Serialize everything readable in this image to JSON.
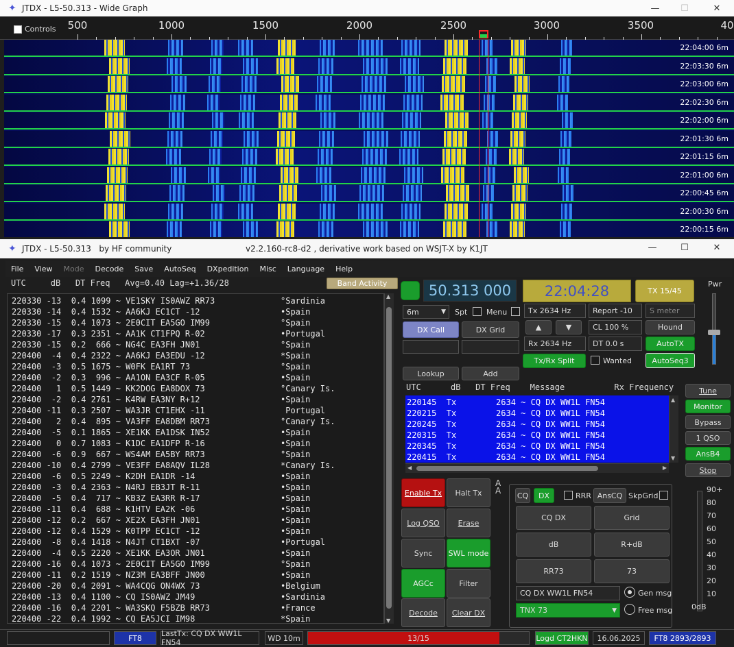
{
  "wide_graph": {
    "title": "JTDX - L5-50.313 - Wide Graph",
    "controls_label": "Controls",
    "scale_labels": [
      "500",
      "1000",
      "1500",
      "2000",
      "2500",
      "3000",
      "3500",
      "40"
    ],
    "rows": [
      {
        "time": "22:04:00",
        "band": "6m"
      },
      {
        "time": "22:03:30",
        "band": "6m"
      },
      {
        "time": "22:03:00",
        "band": "6m"
      },
      {
        "time": "22:02:30",
        "band": "6m"
      },
      {
        "time": "22:02:00",
        "band": "6m"
      },
      {
        "time": "22:01:30",
        "band": "6m"
      },
      {
        "time": "22:01:15",
        "band": "6m"
      },
      {
        "time": "22:01:00",
        "band": "6m"
      },
      {
        "time": "22:00:45",
        "band": "6m"
      },
      {
        "time": "22:00:30",
        "band": "6m"
      },
      {
        "time": "22:00:15",
        "band": "6m"
      }
    ]
  },
  "main": {
    "title_left": "JTDX - L5-50.313   by HF community",
    "title_right": "v2.2.160-rc8-d2 , derivative work based on WSJT-X by K1JT",
    "menu": [
      "File",
      "View",
      "Mode",
      "Decode",
      "Save",
      "AutoSeq",
      "DXpedition",
      "Misc",
      "Language",
      "Help"
    ],
    "decode_header": "UTC     dB   DT Freq   Avg=0.40 Lag=+1.36/28",
    "band_activity": "Band Activity",
    "decodes": [
      {
        "line": "220330 -13  0.4 1099 ~ VE1SKY IS0AWZ RR73",
        "country": "°Sardinia"
      },
      {
        "line": "220330 -14  0.4 1532 ~ AA6KJ EC1CT -12",
        "country": "•Spain"
      },
      {
        "line": "220330 -15  0.4 1073 ~ 2E0CIT EA5GO IM99",
        "country": "°Spain"
      },
      {
        "line": "220330 -17  0.3 2351 ~ AA1K CT1FPQ R-02",
        "country": "•Portugal"
      },
      {
        "line": "220330 -15  0.2  666 ~ NG4C EA3FH JN01",
        "country": "°Spain"
      },
      {
        "line": "220400  -4  0.4 2322 ~ AA6KJ EA3EDU -12",
        "country": "*Spain"
      },
      {
        "line": "220400  -3  0.5 1675 ~ W0FK EA1RT 73",
        "country": "°Spain"
      },
      {
        "line": "220400  -2  0.3  996 ~ AA1ON EA3CF R-05",
        "country": "•Spain"
      },
      {
        "line": "220400   1  0.5 1449 ~ KK2DOG EA8DOX 73",
        "country": "°Canary Is."
      },
      {
        "line": "220400  -2  0.4 2761 ~ K4RW EA3NY R+12",
        "country": "•Spain"
      },
      {
        "line": "220400 -11  0.3 2507 ~ WA3JR CT1EHX -11",
        "country": " Portugal"
      },
      {
        "line": "220400   2  0.4  895 ~ VA3FF EA8DBM RR73",
        "country": "°Canary Is."
      },
      {
        "line": "220400  -5  0.1 1865 ~ XE1KK EA1DSK IN52",
        "country": "•Spain"
      },
      {
        "line": "220400   0  0.7 1083 ~ K1DC EA1DFP R-16",
        "country": "•Spain"
      },
      {
        "line": "220400  -6  0.9  667 ~ WS4AM EA5BY RR73",
        "country": "°Spain"
      },
      {
        "line": "220400 -10  0.4 2799 ~ VE3FF EA8AQV IL28",
        "country": "*Canary Is."
      },
      {
        "line": "220400  -6  0.5 2249 ~ K2DH EA1DR -14",
        "country": "•Spain"
      },
      {
        "line": "220400  -3  0.4 2363 ~ N4RJ EB3JT R-11",
        "country": "•Spain"
      },
      {
        "line": "220400  -5  0.4  717 ~ KB3Z EA3RR R-17",
        "country": "•Spain"
      },
      {
        "line": "220400 -11  0.4  688 ~ K1HTV EA2K -06",
        "country": "•Spain"
      },
      {
        "line": "220400 -12  0.2  667 ~ XE2X EA3FH JN01",
        "country": "•Spain"
      },
      {
        "line": "220400 -12  0.4 1529 ~ K0TPP EC1CT -12",
        "country": "•Spain"
      },
      {
        "line": "220400  -8  0.4 1418 ~ N4JT CT1BXT -07",
        "country": "•Portugal"
      },
      {
        "line": "220400  -4  0.5 2220 ~ XE1KK EA3OR JN01",
        "country": "•Spain"
      },
      {
        "line": "220400 -16  0.4 1073 ~ 2E0CIT EA5GO IM99",
        "country": "°Spain"
      },
      {
        "line": "220400 -11  0.2 1519 ~ NZ3M EA3BFF JN00",
        "country": "•Spain"
      },
      {
        "line": "220400 -20  0.4 2091 ~ WA4CQG ON4WX 73",
        "country": "•Belgium"
      },
      {
        "line": "220400 -13  0.4 1100 ~ CQ IS0AWZ JM49",
        "country": "•Sardinia"
      },
      {
        "line": "220400 -16  0.4 2201 ~ WA3SKQ F5BZB RR73",
        "country": "•France"
      },
      {
        "line": "220400 -22  0.4 1992 ~ CQ EA5JCI IM98",
        "country": "*Spain"
      }
    ],
    "frequency": "50.313 000",
    "time": "22:04:28",
    "tx_period": "TX 15/45",
    "pwr_label": "Pwr",
    "pwr_level": 0.45,
    "band": "6m",
    "spt_label": "Spt",
    "menu_label": "Menu",
    "dx_call_label": "DX Call",
    "dx_grid_label": "DX Grid",
    "lookup_label": "Lookup",
    "add_label": "Add",
    "tx_freq": "Tx  2634 Hz",
    "rx_freq": "Rx  2634 Hz",
    "report": "Report -10",
    "s_meter_placeholder": "S meter",
    "cl": "CL  100 %",
    "dt": "DT 0.0 s",
    "hound_label": "Hound",
    "autotx_label": "AutoTX",
    "autoseq3_label": "AutoSeq3",
    "txrx_split_label": "Tx/Rx Split",
    "wanted_label": "Wanted",
    "tx_header": "UTC      dB   DT Freq    Message          Rx Frequency",
    "tx_messages": [
      "220145  Tx        2634 ~ CQ DX WW1L FN54",
      "220215  Tx        2634 ~ CQ DX WW1L FN54",
      "220245  Tx        2634 ~ CQ DX WW1L FN54",
      "220315  Tx        2634 ~ CQ DX WW1L FN54",
      "220345  Tx        2634 ~ CQ DX WW1L FN54",
      "220415  Tx        2634 ~ CQ DX WW1L FN54"
    ],
    "side_buttons": [
      "Tune",
      "Monitor",
      "Bypass",
      "1 QSO",
      "AnsB4",
      "Stop"
    ],
    "enable_tx": "Enable Tx",
    "halt_tx": "Halt Tx",
    "log_qso": "Log QSO",
    "erase": "Erase",
    "sync": "Sync",
    "swl_mode": "SWL mode",
    "agcc": "AGCc",
    "filter": "Filter",
    "decode": "Decode",
    "clear_dx": "Clear DX",
    "cq_label": "CQ",
    "dx_label": "DX",
    "rrr_label": "RRR",
    "anscq_label": "AnsCQ",
    "skpgrid_label": "SkpGrid",
    "cq_dx_btn": "CQ DX",
    "grid_btn": "Grid",
    "db_btn": "dB",
    "r_db_btn": "R+dB",
    "rr73_btn": "RR73",
    "73_btn": "73",
    "gen_msg_value": "CQ DX WW1L FN54",
    "gen_msg_label": "Gen msg",
    "free_msg_value": "TNX 73",
    "free_msg_label": "Free msg",
    "meter_scale": [
      "90+",
      "80",
      "70",
      "60",
      "50",
      "40",
      "30",
      "20",
      "10",
      "0dB"
    ],
    "status": {
      "mode": "FT8",
      "last_tx": "LastTx: CQ DX WW1L FN54",
      "wd": "WD 10m",
      "progress": "13/15",
      "progress_fraction": 0.8667,
      "logged": "Logd CT2HKN",
      "date": "16.06.2025",
      "ft8_count": "FT8  2893/2893"
    }
  },
  "colors": {
    "accent_green": "#1a9d2c",
    "tx_blue": "#0a12e8",
    "freq_bg": "#1a3746",
    "time_bg": "#b8aa3c",
    "enable_tx_red": "#b51111",
    "waterfall_line": "#22d24a"
  }
}
